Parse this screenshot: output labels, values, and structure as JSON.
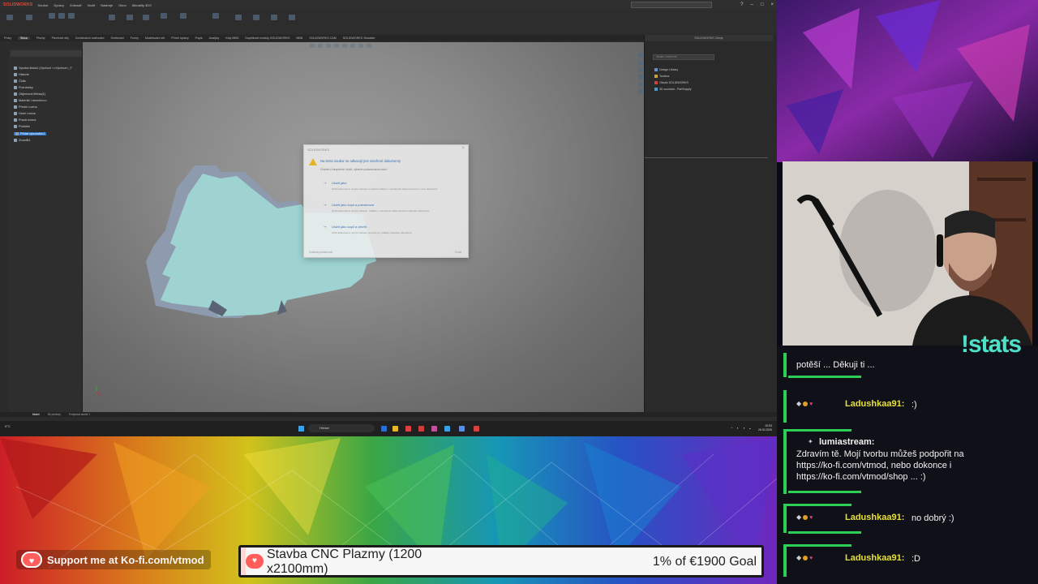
{
  "solidworks": {
    "logo": "SOLIDWORKS",
    "menu": [
      "Soubor",
      "Úpravy",
      "Zobrazit",
      "Vložit",
      "Nástroje",
      "Okno",
      "Aktuality 3DX"
    ],
    "window_controls": [
      "?",
      "–",
      "□",
      "×"
    ],
    "tabs": [
      "Prvky",
      "Skica",
      "Plochy",
      "Plechové díly",
      "Konstrukční svařování",
      "Svařování",
      "Formy",
      "Modelování sítí",
      "Přímé úpravy",
      "Popis",
      "Analýzy",
      "Kóty MBD",
      "Doplňkové moduly SOLIDWORKS",
      "MBD",
      "SOLIDWORKS CAM",
      "SOLIDWORKS Visualize"
    ],
    "active_tab": "Skica",
    "tree": [
      {
        "label": "Vysoká škola1 (Výchozí <<Výchozí>_F",
        "selected": false
      },
      {
        "label": "Historie",
        "selected": false
      },
      {
        "label": "Čidla",
        "selected": false
      },
      {
        "label": "Poznámky",
        "selected": false
      },
      {
        "label": "Objemová tělesa(1)",
        "selected": false
      },
      {
        "label": "Materiál <neurčeno>",
        "selected": false
      },
      {
        "label": "Přední rovina",
        "selected": false
      },
      {
        "label": "Horní rovina",
        "selected": false
      },
      {
        "label": "Pravá rovina",
        "selected": false
      },
      {
        "label": "Počátek",
        "selected": false
      },
      {
        "label": "Přidat vysunutím1",
        "selected": true
      },
      {
        "label": "Zrcadlit1",
        "selected": false
      }
    ],
    "dialog": {
      "title": "SOLIDWORKS",
      "close": "×",
      "heading": "Na tento soubor se odkazují jiné otevřené dokumenty",
      "subheading": "Chcete-li bezpečně uložit, vyberte požadovanou akci:",
      "options": [
        {
          "title": "Uložit jako",
          "desc": "Uloží dokument s novým názvem a nahradí odkazy v otevřených dokumentech na nový dokument."
        },
        {
          "title": "Uložit jako kopii a pokračovat",
          "desc": "Uloží dokument s novým názvem. Odkazy v otevřených dokumentech nebudou nahrazeny."
        },
        {
          "title": "Uložit jako kopii a otevřít",
          "desc": "Uloží dokument s novým názvem a otevře jej. Odkazy nebudou nahrazeny."
        }
      ],
      "footer_left": "Zobrazit podrobnosti",
      "footer_right": "Zrušit"
    },
    "taskpane": {
      "header": "SOLIDWORKS Zdroje",
      "search_placeholder": "Hledat v knihovně",
      "items": [
        "Design Library",
        "Toolbox",
        "Obsah SOLIDWORKS",
        "3D součásti - PartSupply"
      ]
    },
    "status_tabs": [
      "Model",
      "3D pohledy",
      "Pohybová studie 1"
    ],
    "active_status_tab": "Model"
  },
  "taskbar": {
    "weather": "5°C",
    "search_label": "Hledat",
    "clock_time": "20:53",
    "clock_date": "26.02.2026",
    "app_colors": [
      "#2a6fd6",
      "#e8b82a",
      "#e04040",
      "#d33a3a",
      "#c44f9a",
      "#3aa0e8",
      "#5b8de6",
      "#d94040"
    ]
  },
  "overlay": {
    "stats_label": "!stats",
    "kofi_label": "Support me at Ko-fi.com/vtmod",
    "goal": {
      "title": "Stavba CNC Plazmy (1200 x2100mm)",
      "progress_text": "1% of €1900 Goal",
      "progress_percent": 1
    }
  },
  "chat": [
    {
      "user": "",
      "lines": [
        "potěší ... Děkuji ti ..."
      ],
      "badges": false
    },
    {
      "user": "Ladushkaa91:",
      "lines": [
        ":)"
      ],
      "badges": true
    },
    {
      "user": "lumiastream:",
      "lines": [
        "Zdravím tě. Mojí tvorbu můžeš podpořit na",
        "https://ko-fi.com/vtmod, nebo dokonce i",
        "https://ko-fi.com/vtmod/shop ... :)"
      ],
      "badges": false
    },
    {
      "user": "Ladushkaa91:",
      "lines": [
        "no dobrý :)"
      ],
      "badges": true
    },
    {
      "user": "Ladushkaa91:",
      "lines": [
        ":D"
      ],
      "badges": true
    }
  ],
  "colors": {
    "chat_accent": "#2ccf56",
    "chat_username": "#e6e03a",
    "stats_text": "#4ee0c8",
    "kofi_red": "#ff5e5b",
    "part_face": "#9ed3d1",
    "part_side": "#8e9aae"
  },
  "icons": [
    "solidworks-logo-icon",
    "warning-icon",
    "arrow-right-icon",
    "kofi-cup-icon",
    "windows-start-icon",
    "search-icon",
    "heart-icon",
    "chat-bubble-icon"
  ]
}
